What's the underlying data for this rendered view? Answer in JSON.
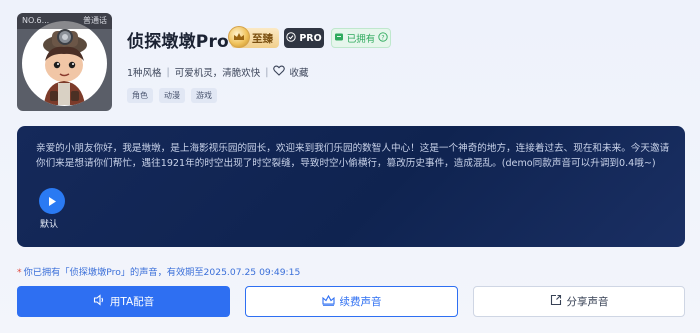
{
  "voice": {
    "title": "侦探墩墩Pro",
    "avatar_no": "NO.6...",
    "avatar_lang": "普通话",
    "badge_tier": "至臻",
    "badge_pro": "PRO",
    "badge_owned": "已拥有",
    "style_count": "1种风格",
    "description": "可爱机灵，清脆欢快",
    "favorite_label": "收藏",
    "tags": [
      "角色",
      "动漫",
      "游戏"
    ]
  },
  "intro": {
    "text": "亲爱的小朋友你好，我是墩墩，是上海影视乐园的园长，欢迎来到我们乐园的数智人中心！这是一个神奇的地方，连接着过去、现在和未来。今天邀请你们来是想请你们帮忙，遇往1921年的时空出现了时空裂缝，导致时空小偷横行，篡改历史事件，造成混乱。(demo同款声音可以升调到0.4哦~)",
    "play_label": "默认"
  },
  "notice": {
    "star": "*",
    "text": "你已拥有「侦探墩墩Pro」的声音，有效期至2025.07.25 09:49:15"
  },
  "actions": {
    "use_voice": "用TA配音",
    "renew_voice": "续费声音",
    "share_voice": "分享声音"
  },
  "colors": {
    "accent": "#2e6ff2",
    "card_bg": "#15295a",
    "owned_green": "#2faa5e",
    "gold": "#f1cf8c"
  },
  "icons": {
    "tier": "crown-icon",
    "pro": "shield-check-icon",
    "owned": "ticket-icon",
    "owned_help": "question-circle-icon",
    "favorite": "heart-outline-icon",
    "play": "play-icon",
    "use_voice": "microphone-icon",
    "renew": "crown-outline-icon",
    "share": "share-icon"
  }
}
